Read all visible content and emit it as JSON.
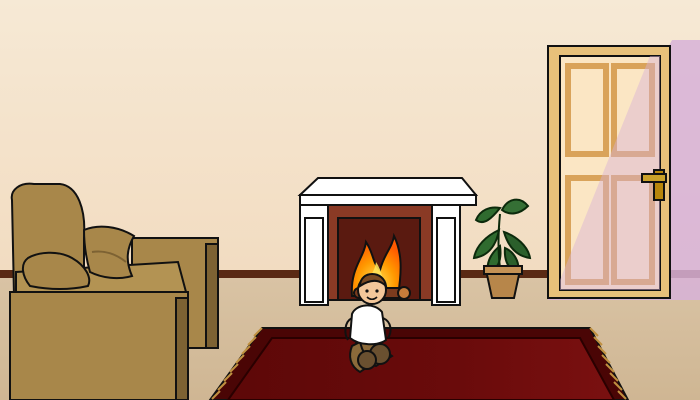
{
  "scene": {
    "name": "living room",
    "palette": {
      "wall": "#f6e9d5",
      "floor": "#d6c0a0",
      "baseboard": "#5a2a14",
      "outline": "#111111",
      "sofa": "#a8874a",
      "sofa_dark": "#7d6233",
      "fireplace_white": "#ffffff",
      "fireplace_brick": "#8a3a25",
      "fire_orange": "#ff7a00",
      "fire_yellow": "#ffd000",
      "log": "#7a3b1e",
      "rug": "#6b0b0b",
      "rug_border": "#4a0505",
      "fringe": "#c09040",
      "door_frame": "#e8c17a",
      "door_panel": "#fbe6c4",
      "door_handle": "#b8860b",
      "shadow_lilac": "#d7b2d8",
      "plant": "#2f6b2f",
      "pot": "#b7864a",
      "child_skin": "#f3c79a",
      "child_hair": "#7a4a22",
      "child_shirt": "#ffffff",
      "child_pants": "#8b6a3a"
    },
    "objects": [
      "sofa",
      "cushion",
      "fireplace",
      "fire",
      "potted-plant",
      "door",
      "door-handle",
      "rug",
      "child-character"
    ]
  }
}
